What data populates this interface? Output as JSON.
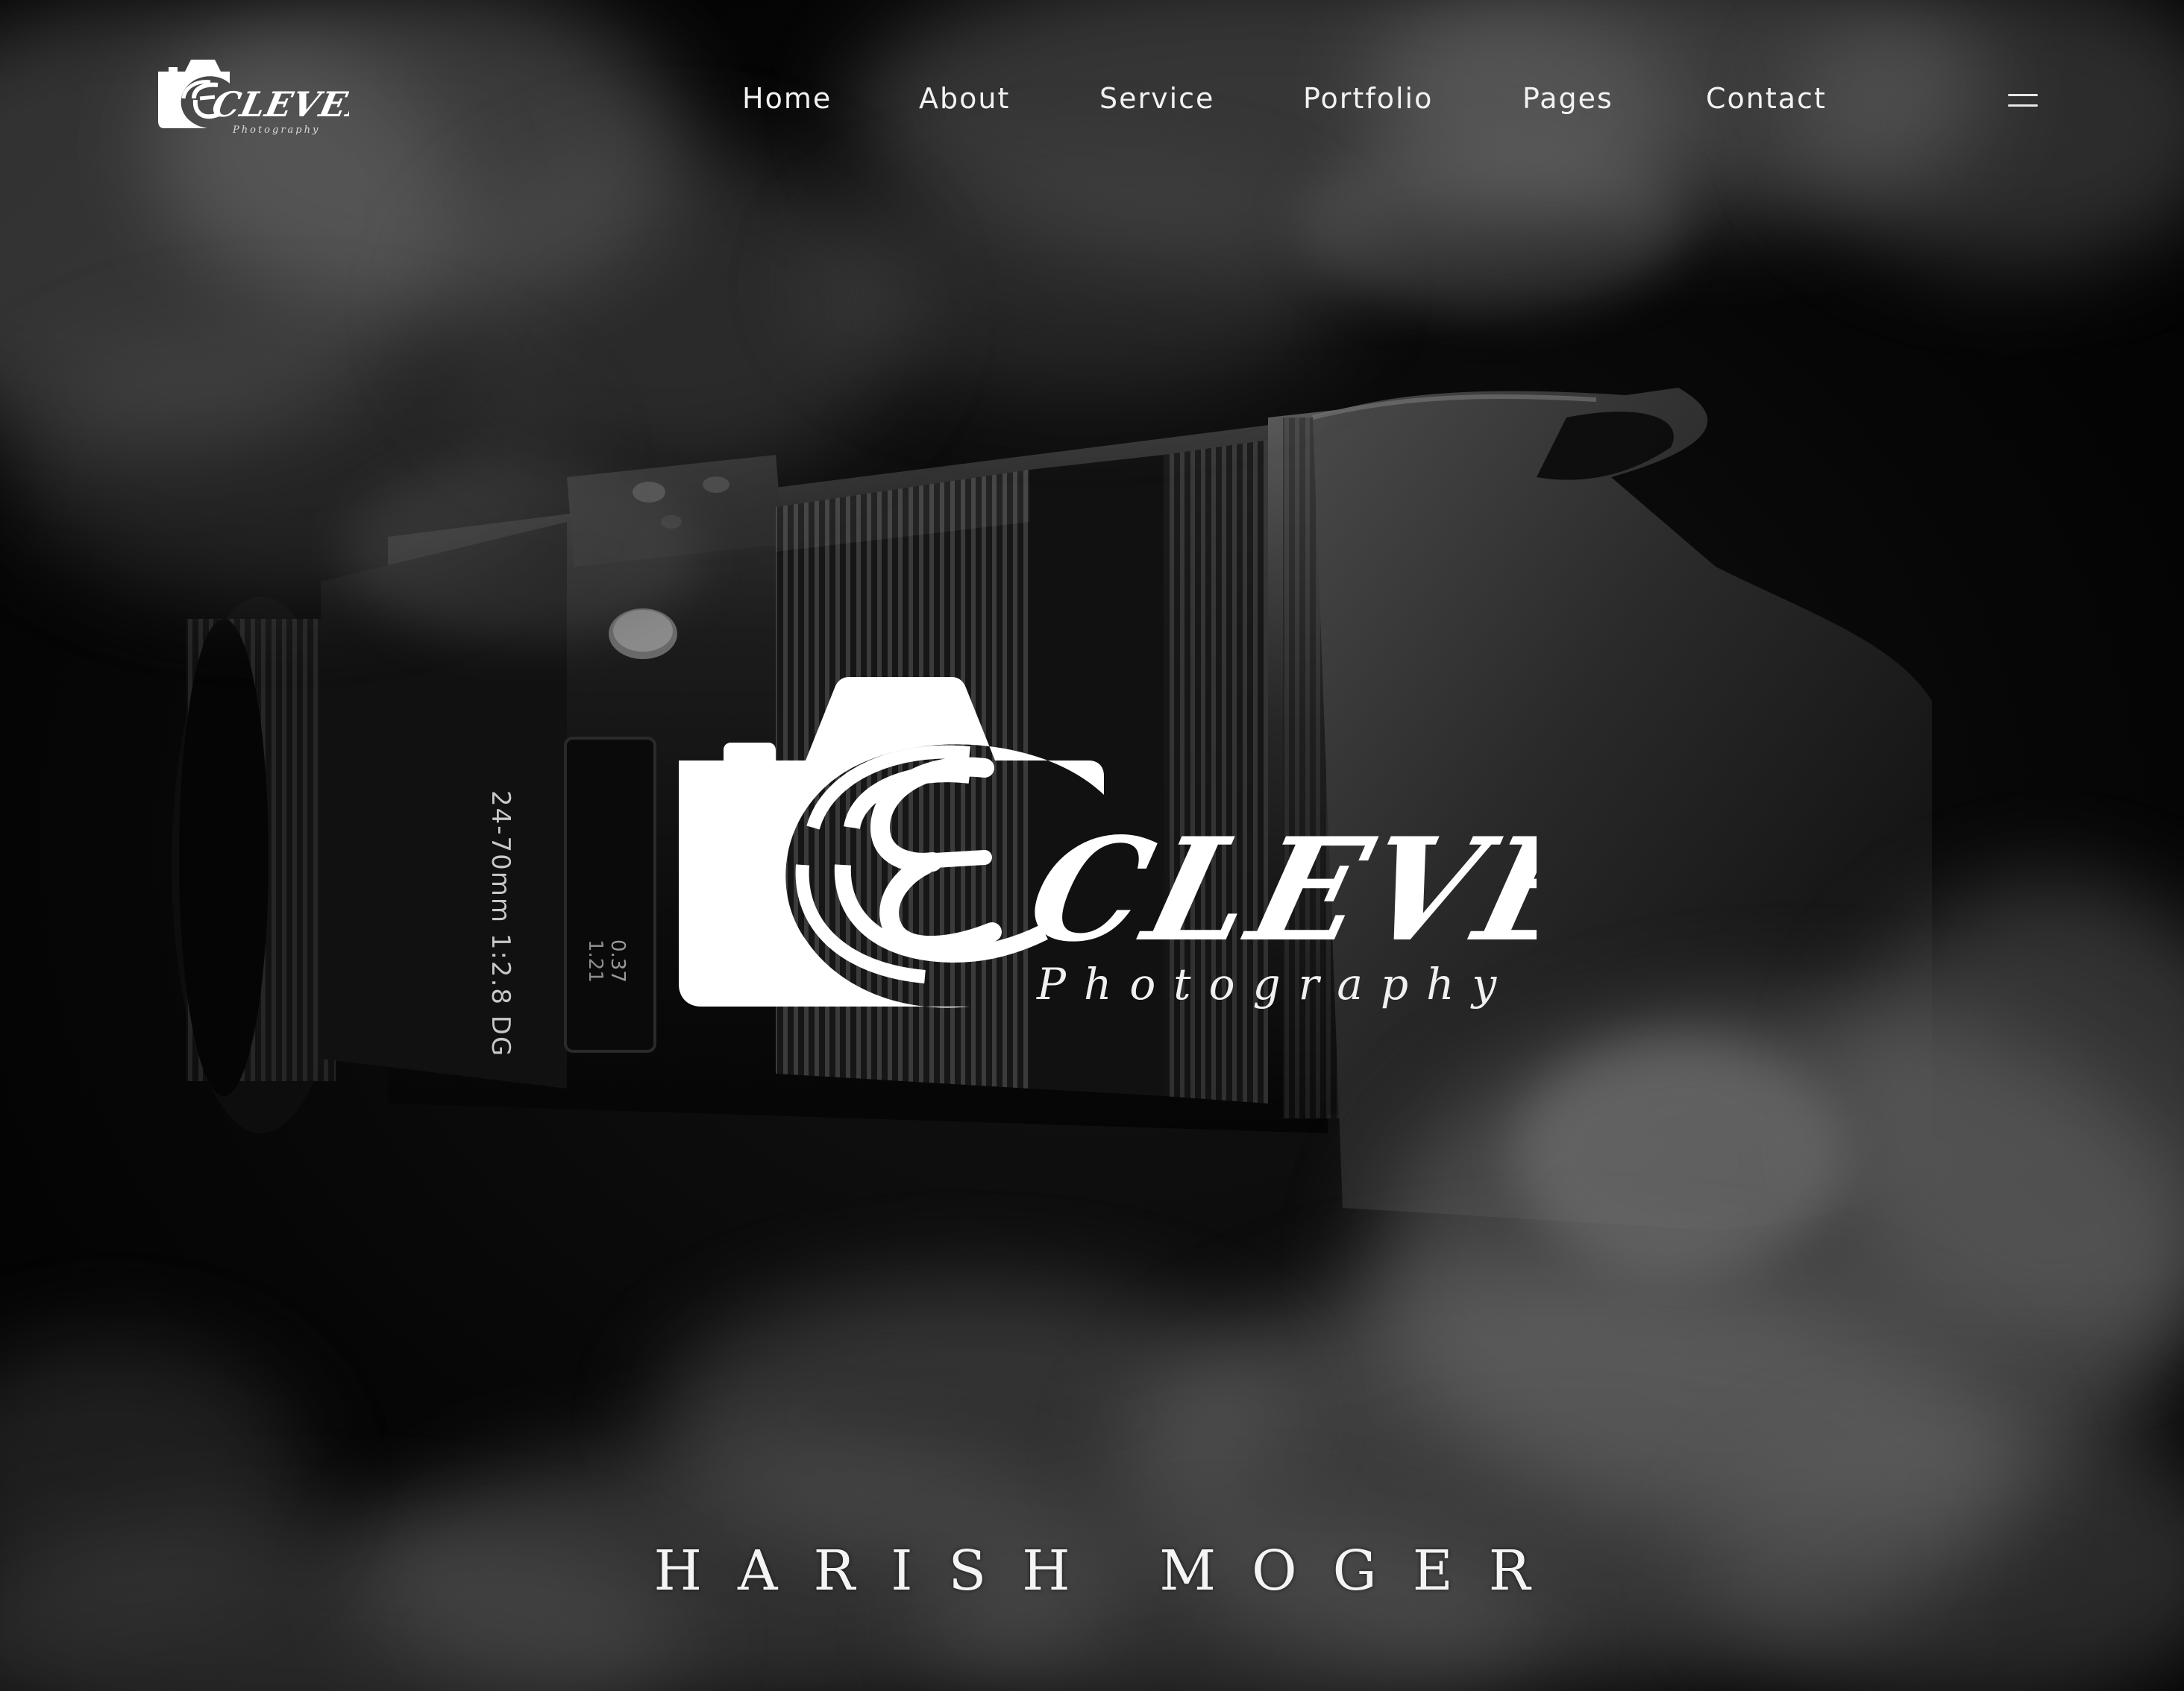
{
  "brand": {
    "logo_name": "CLEVEN",
    "logo_tagline": "Photography"
  },
  "nav": {
    "items": [
      {
        "label": "Home"
      },
      {
        "label": "About"
      },
      {
        "label": "Service"
      },
      {
        "label": "Portfolio"
      },
      {
        "label": "Pages"
      },
      {
        "label": "Contact"
      }
    ],
    "menu_icon": "hamburger-menu-icon"
  },
  "hero": {
    "logo_name": "CLEVEN",
    "logo_tagline": "Photography",
    "lens_text_1": "24-70mm 1:2.8 DG",
    "lens_text_2": "1.21",
    "lens_text_3": "0.37",
    "name": "HARISH MOGER"
  },
  "colors": {
    "background": "#030303",
    "text": "#f2f2f2",
    "smoke": "#8a8a8a"
  }
}
